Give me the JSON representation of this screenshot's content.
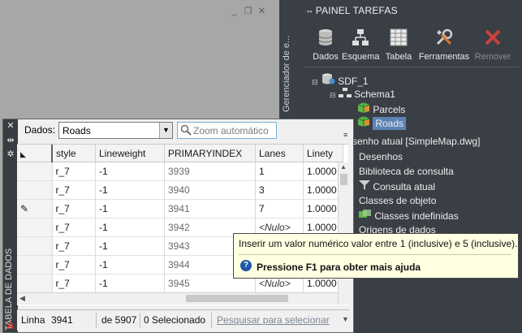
{
  "window_controls": [
    "_",
    "❐",
    "✕"
  ],
  "palette_strip": {
    "label": "Gerenciador de e..."
  },
  "panel": {
    "title": "PAINEL TAREFAS",
    "tools": [
      {
        "label": "Dados",
        "icon": "database-icon",
        "enabled": true
      },
      {
        "label": "Esquema",
        "icon": "schema-icon",
        "enabled": true
      },
      {
        "label": "Tabela",
        "icon": "table-icon",
        "enabled": true
      },
      {
        "label": "Ferramentas",
        "icon": "tools-icon",
        "enabled": true
      },
      {
        "label": "Remover",
        "icon": "remove-icon",
        "enabled": false
      }
    ],
    "tree": {
      "root": "SDF_1",
      "schema": "Schema1",
      "items": [
        "Parcels",
        "Roads"
      ],
      "selected": "Roads"
    },
    "drawing_list": [
      "senho atual [SimpleMap.dwg]",
      "Desenhos",
      "Biblioteca de consulta",
      "Consulta atual",
      "Classes de objeto",
      "Classes indefinidas",
      "Origens de dados"
    ]
  },
  "data_table": {
    "side_label": "TABELA DE DADOS",
    "data_label": "Dados:",
    "dataset_value": "Roads",
    "zoom_label": "Zoom automático",
    "columns": [
      "",
      "style",
      "Lineweight",
      "PRIMARYINDEX",
      "Lanes",
      "Linety"
    ],
    "rows": [
      {
        "mark": "",
        "style": "r_7",
        "lineweight": "-1",
        "primaryindex": "3939",
        "lanes": "1",
        "linety": "1.0000"
      },
      {
        "mark": "",
        "style": "r_7",
        "lineweight": "-1",
        "primaryindex": "3940",
        "lanes": "3",
        "linety": "1.0000"
      },
      {
        "mark": "✎",
        "style": "r_7",
        "lineweight": "-1",
        "primaryindex": "3941",
        "lanes": "7",
        "linety": "1.0000"
      },
      {
        "mark": "",
        "style": "r_7",
        "lineweight": "-1",
        "primaryindex": "3942",
        "lanes": "<Nulo>",
        "linety": "1.0000"
      },
      {
        "mark": "",
        "style": "r_7",
        "lineweight": "-1",
        "primaryindex": "3943",
        "lanes": "",
        "linety": ""
      },
      {
        "mark": "",
        "style": "r_7",
        "lineweight": "-1",
        "primaryindex": "3944",
        "lanes": "",
        "linety": ""
      },
      {
        "mark": "",
        "style": "r_7",
        "lineweight": "-1",
        "primaryindex": "3945",
        "lanes": "<Nulo>",
        "linety": "1.0000"
      }
    ],
    "status": {
      "linha_label": "Linha",
      "linha_value": "3941",
      "of_total": "de 5907",
      "selected": "0 Selecionado",
      "search_link": "Pesquisar para selecionar"
    }
  },
  "tooltip": {
    "line1": "Inserir um valor numérico valor entre 1 (inclusive) e 5 (inclusive).",
    "line2": "Pressione F1 para obter mais ajuda",
    "help_glyph": "?"
  }
}
